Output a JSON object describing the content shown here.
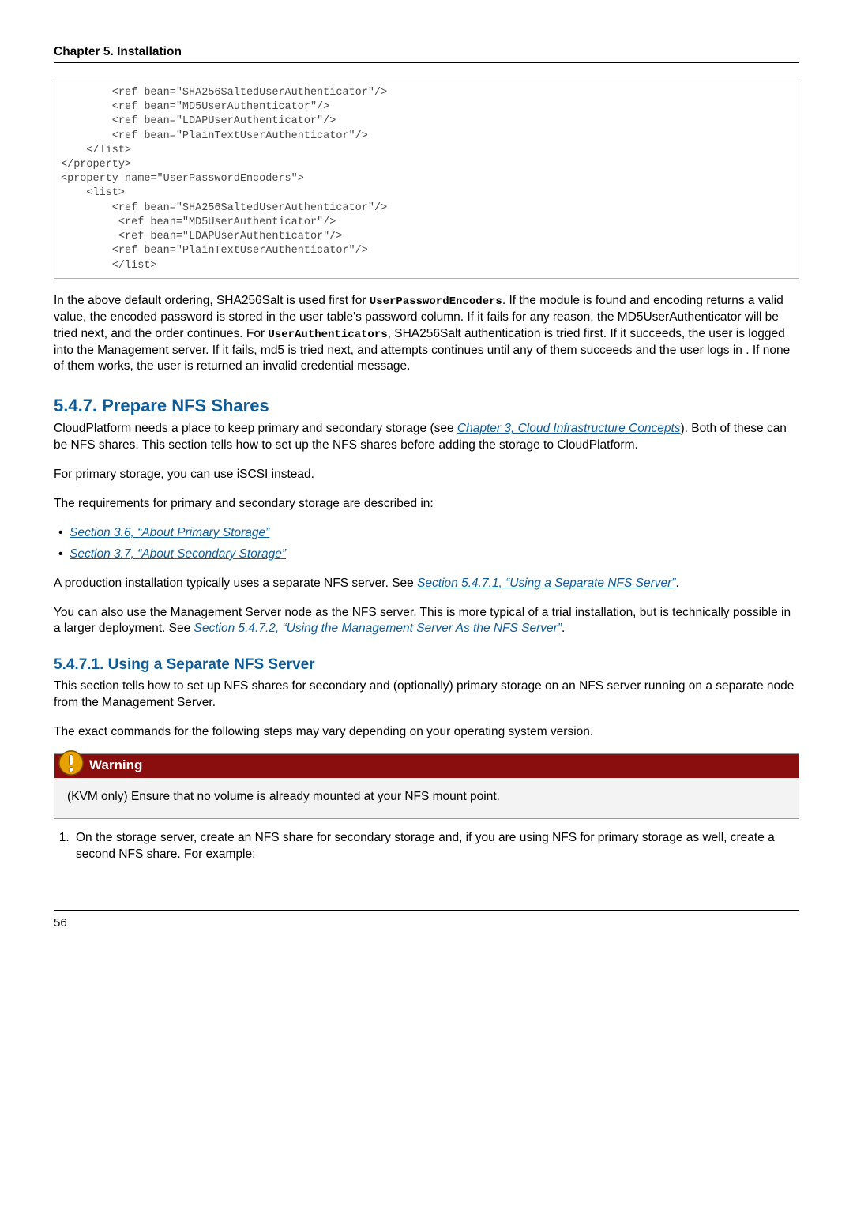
{
  "header": {
    "chapter": "Chapter 5. Installation"
  },
  "code1": "        <ref bean=\"SHA256SaltedUserAuthenticator\"/>\n        <ref bean=\"MD5UserAuthenticator\"/>\n        <ref bean=\"LDAPUserAuthenticator\"/>\n        <ref bean=\"PlainTextUserAuthenticator\"/>\n    </list>\n</property>\n<property name=\"UserPasswordEncoders\">\n    <list>\n        <ref bean=\"SHA256SaltedUserAuthenticator\"/>\n         <ref bean=\"MD5UserAuthenticator\"/>\n         <ref bean=\"LDAPUserAuthenticator\"/>\n        <ref bean=\"PlainTextUserAuthenticator\"/>\n        </list>",
  "para1": {
    "t1": "In the above default ordering, SHA256Salt is used first for ",
    "c1": "UserPasswordEncoders",
    "t2": ". If the module is found and encoding returns a valid value, the encoded password is stored in the user table's password column. If it fails for any reason, the MD5UserAuthenticator will be tried next, and the order continues. For ",
    "c2": "UserAuthenticators",
    "t3": ", SHA256Salt authentication is tried first. If it succeeds, the user is logged into the Management server. If it fails, md5 is tried next, and attempts continues until any of them succeeds and the user logs in . If none of them works, the user is returned an invalid credential message."
  },
  "sec547": {
    "title": "5.4.7. Prepare NFS Shares",
    "p1a": "CloudPlatform needs a place to keep primary and secondary storage (see ",
    "link1": "Chapter 3, Cloud Infrastructure Concepts",
    "p1b": "). Both of these can be NFS shares. This section tells how to set up the NFS shares before adding the storage to CloudPlatform.",
    "p2": "For primary storage, you can use iSCSI instead.",
    "p3": "The requirements for primary and secondary storage are described in:",
    "b1": "Section 3.6, “About Primary Storage”",
    "b2": "Section 3.7, “About Secondary Storage”",
    "p4a": "A production installation typically uses a separate NFS server. See ",
    "link4": "Section 5.4.7.1, “Using a Separate NFS Server”",
    "p4b": ".",
    "p5a": "You can also use the Management Server node as the NFS server. This is more typical of a trial installation, but is technically possible in a larger deployment. See ",
    "link5": "Section 5.4.7.2, “Using the Management Server As the NFS Server”",
    "p5b": "."
  },
  "sec5471": {
    "title": "5.4.7.1. Using a Separate NFS Server",
    "p1": "This section tells how to set up NFS shares for secondary and (optionally) primary storage on an NFS server running on a separate node from the Management Server.",
    "p2": "The exact commands for the following steps may vary depending on your operating system version."
  },
  "warning": {
    "title": "Warning",
    "body": "(KVM only) Ensure that no volume is already mounted at your NFS mount point."
  },
  "step1": "On the storage server, create an NFS share for secondary storage and, if you are using NFS for primary storage as well, create a second NFS share. For example:",
  "footer": {
    "page": "56"
  }
}
